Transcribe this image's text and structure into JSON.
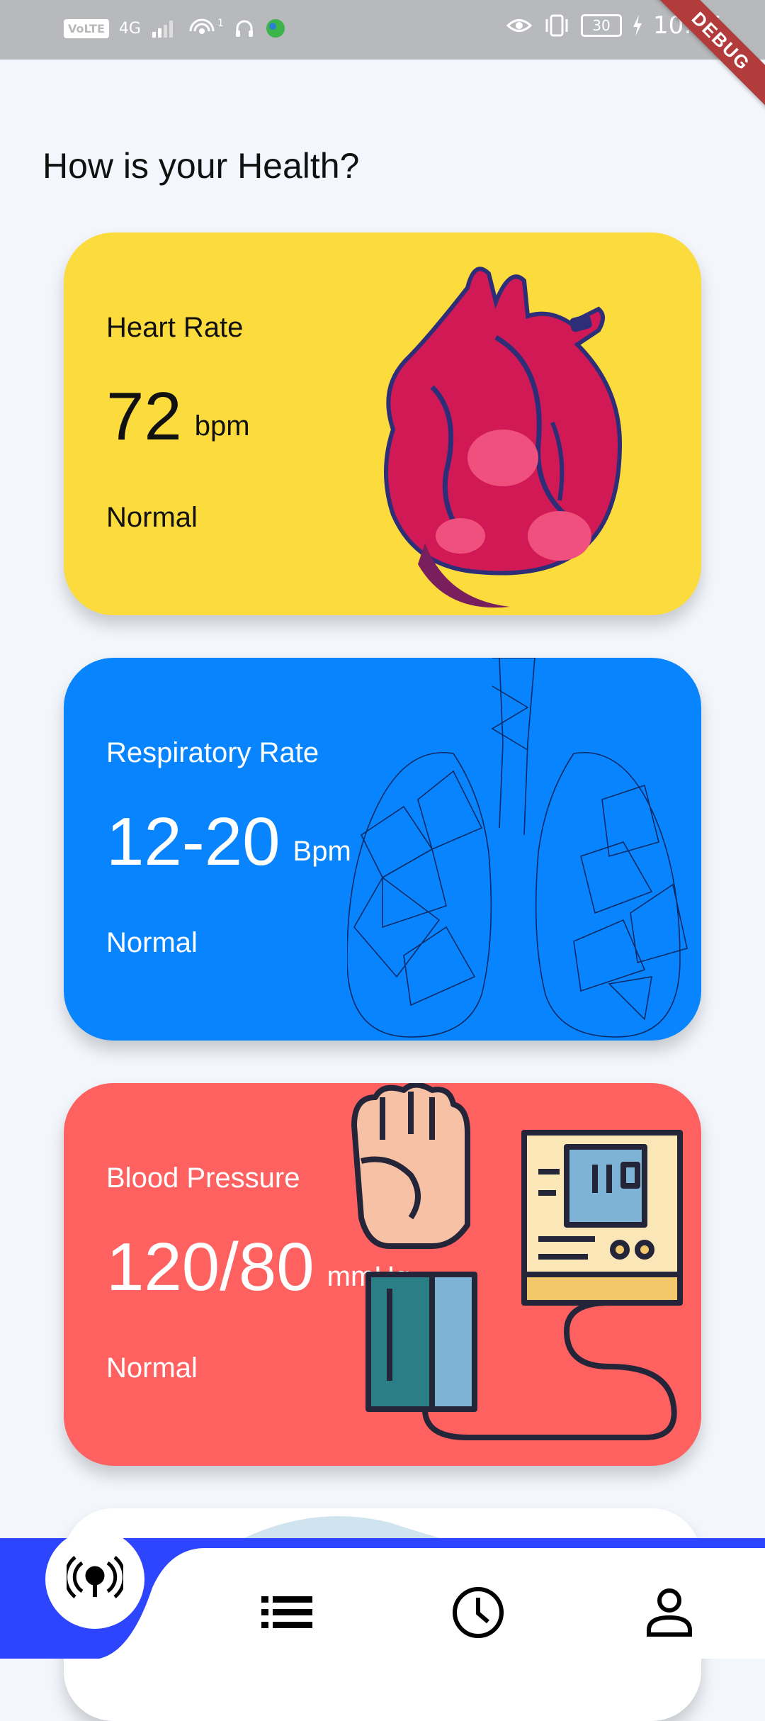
{
  "status_bar": {
    "left_icons": [
      "volte-icon",
      "4g-signal-icon",
      "hotspot-icon",
      "headphones-icon",
      "app-icon"
    ],
    "volte_label": "VoLTE",
    "network_label": "4G",
    "hotspot_count": "1",
    "battery": "30",
    "time": "10:35",
    "right_icons": [
      "eye-icon",
      "vibrate-icon",
      "battery-icon",
      "charging-icon"
    ]
  },
  "debug_banner": "DEBUG",
  "page_title": "How is your Health?",
  "cards": [
    {
      "title": "Heart Rate",
      "value": "72",
      "unit": "bpm",
      "status": "Normal",
      "color": "#fcdc3d",
      "illustration": "heart-illustration"
    },
    {
      "title": "Respiratory Rate",
      "value": "12-20",
      "unit": "Bpm",
      "status": "Normal",
      "color": "#0885fe",
      "illustration": "lungs-illustration"
    },
    {
      "title": "Blood Pressure",
      "value": "120/80",
      "unit": "mmHg",
      "status": "Normal",
      "color": "#fe6160",
      "illustration": "blood-pressure-monitor-illustration"
    }
  ],
  "bottom_nav": {
    "accent": "#2d45ff",
    "items": [
      {
        "icon": "broadcast-icon",
        "active": true
      },
      {
        "icon": "list-icon",
        "active": false
      },
      {
        "icon": "clock-icon",
        "active": false
      },
      {
        "icon": "person-icon",
        "active": false
      }
    ]
  }
}
